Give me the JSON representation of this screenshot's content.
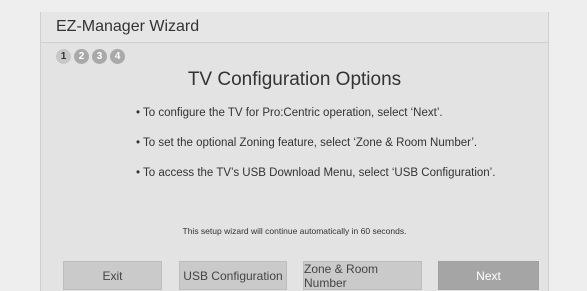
{
  "window": {
    "title": "EZ-Manager Wizard"
  },
  "steps": [
    {
      "label": "1",
      "active": true
    },
    {
      "label": "2",
      "active": false
    },
    {
      "label": "3",
      "active": false
    },
    {
      "label": "4",
      "active": false
    }
  ],
  "main": {
    "heading": "TV Configuration Options",
    "bullets": [
      "• To configure the TV for Pro:Centric operation, select ‘Next’.",
      "• To set the optional Zoning feature, select ‘Zone & Room Number’.",
      "• To access the TV’s USB Download Menu, select ‘USB Configuration’."
    ],
    "notice": "This setup wizard will continue automatically in 60 seconds."
  },
  "buttons": {
    "exit": "Exit",
    "usb": "USB Configuration",
    "zone": "Zone & Room Number",
    "next": "Next"
  }
}
